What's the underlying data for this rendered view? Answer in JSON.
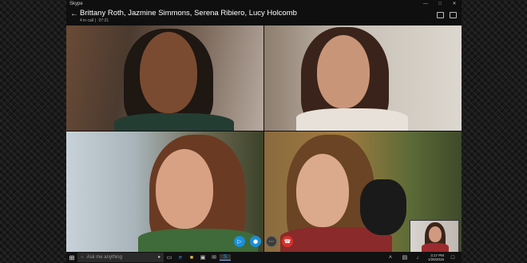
{
  "window": {
    "app_title": "Skype"
  },
  "call": {
    "participants": "Brittany Roth, Jazmine Simmons, Serena Ribiero, Lucy Holcomb",
    "status": "4 in call",
    "duration": "07:21"
  },
  "controls": {
    "video": "video-camera-icon",
    "mute": "microphone-icon",
    "more": "more-icon",
    "end_call": "end-call-icon"
  },
  "taskbar": {
    "search_placeholder": "Ask me anything",
    "time": "3:17 PM",
    "date": "1/25/2016"
  },
  "colors": {
    "accent": "#1b8fd8",
    "end_call": "#d9322b"
  }
}
